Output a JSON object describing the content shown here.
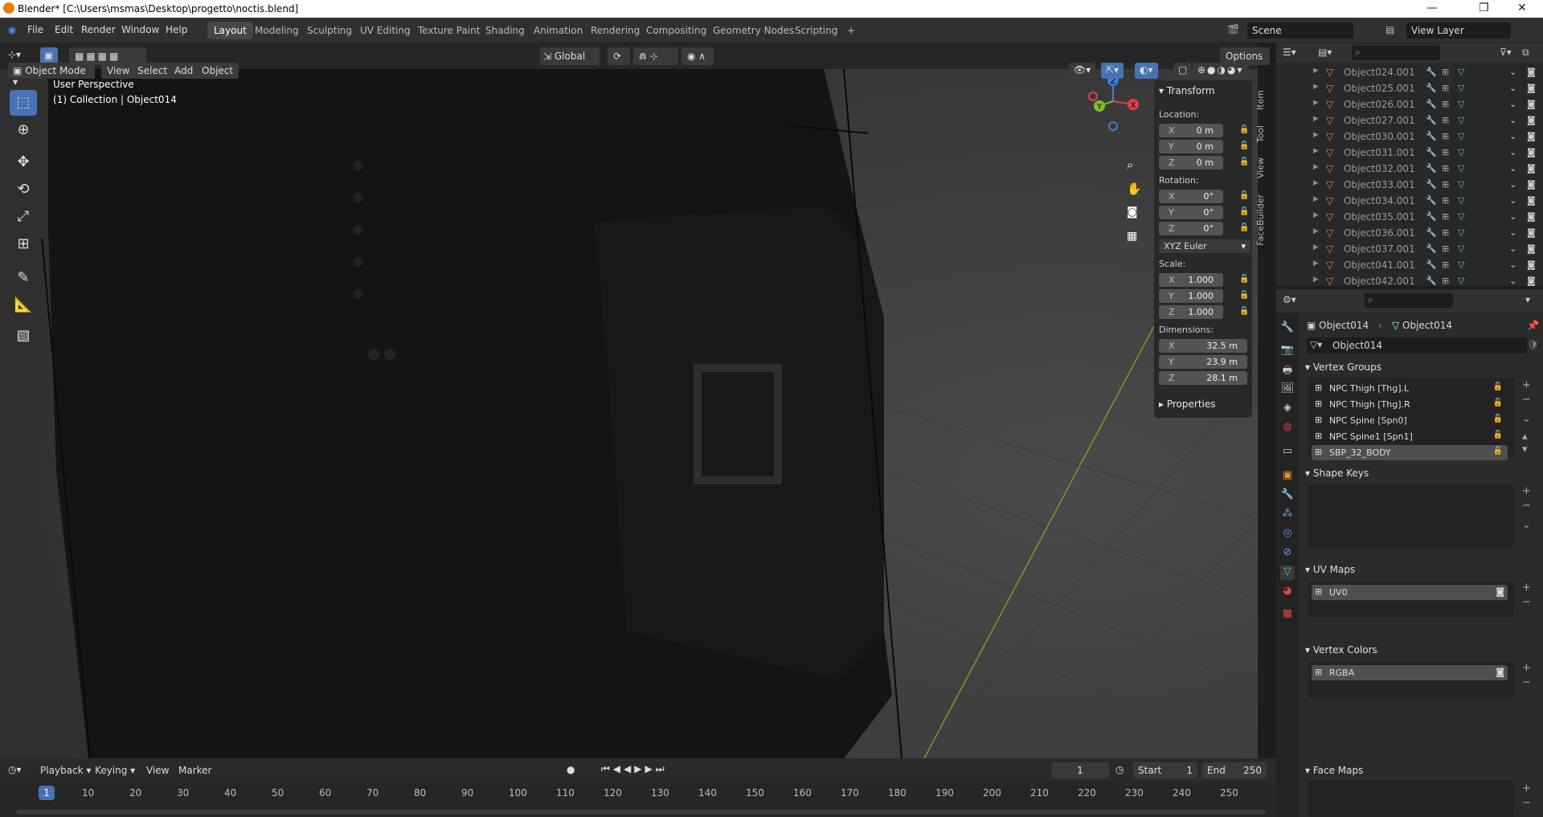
{
  "window": {
    "title": "Blender* [C:\\Users\\msmas\\Desktop\\progetto\\noctis.blend]",
    "controls": [
      "—",
      "❐",
      "✕"
    ]
  },
  "menus": [
    "File",
    "Edit",
    "Render",
    "Window",
    "Help"
  ],
  "workspaces": [
    "Layout",
    "Modeling",
    "Sculpting",
    "UV Editing",
    "Texture Paint",
    "Shading",
    "Animation",
    "Rendering",
    "Compositing",
    "Geometry Nodes",
    "Scripting",
    "+"
  ],
  "scene": {
    "name": "Scene",
    "view_layer": "View Layer"
  },
  "viewport_header": {
    "mode": "Object Mode",
    "menus": [
      "View",
      "Select",
      "Add",
      "Object"
    ],
    "transform_orientation": "Global",
    "options": "Options"
  },
  "viewport": {
    "perspective": "User Perspective",
    "collection_info": "(1) Collection | Object014"
  },
  "gizmo": {
    "axes": [
      "Z",
      "X",
      "Y"
    ],
    "colors": {
      "x": "#e0404a",
      "y": "#7fbd2c",
      "z": "#3d7fd8"
    }
  },
  "npanel": {
    "transform_title": "Transform",
    "location_label": "Location:",
    "location": [
      {
        "ax": "X",
        "v": "0 m"
      },
      {
        "ax": "Y",
        "v": "0 m"
      },
      {
        "ax": "Z",
        "v": "0 m"
      }
    ],
    "rotation_label": "Rotation:",
    "rotation": [
      {
        "ax": "X",
        "v": "0°"
      },
      {
        "ax": "Y",
        "v": "0°"
      },
      {
        "ax": "Z",
        "v": "0°"
      }
    ],
    "rotation_mode": "XYZ Euler",
    "scale_label": "Scale:",
    "scale": [
      {
        "ax": "X",
        "v": "1.000"
      },
      {
        "ax": "Y",
        "v": "1.000"
      },
      {
        "ax": "Z",
        "v": "1.000"
      }
    ],
    "dimensions_label": "Dimensions:",
    "dimensions": [
      {
        "ax": "X",
        "v": "32.5 m"
      },
      {
        "ax": "Y",
        "v": "23.9 m"
      },
      {
        "ax": "Z",
        "v": "28.1 m"
      }
    ],
    "properties_title": "Properties",
    "tabs": [
      "Item",
      "Tool",
      "View",
      "FaceBuilder"
    ]
  },
  "outliner": {
    "items": [
      "Object024.001",
      "Object025.001",
      "Object026.001",
      "Object027.001",
      "Object030.001",
      "Object031.001",
      "Object032.001",
      "Object033.001",
      "Object034.001",
      "Object035.001",
      "Object036.001",
      "Object037.001",
      "Object041.001",
      "Object042.001"
    ]
  },
  "properties": {
    "breadcrumb_object": "Object014",
    "breadcrumb_data": "Object014",
    "datablock_name": "Object014",
    "vertex_groups_title": "Vertex Groups",
    "vertex_groups": [
      "NPC Thigh [Thg].L",
      "NPC Thigh [Thg].R",
      "NPC Spine [Spn0]",
      "NPC Spine1 [Spn1]",
      "SBP_32_BODY"
    ],
    "shape_keys_title": "Shape Keys",
    "uv_maps_title": "UV Maps",
    "uv_maps": [
      "UV0"
    ],
    "vertex_colors_title": "Vertex Colors",
    "vertex_colors": [
      "RGBA"
    ],
    "face_maps_title": "Face Maps"
  },
  "timeline": {
    "menus": [
      "Playback",
      "Keying",
      "View",
      "Marker"
    ],
    "current_frame": "1",
    "start_label": "Start",
    "start": "1",
    "end_label": "End",
    "end": "250",
    "ticks": [
      "1",
      "10",
      "20",
      "30",
      "40",
      "50",
      "60",
      "70",
      "80",
      "90",
      "100",
      "110",
      "120",
      "130",
      "140",
      "150",
      "160",
      "170",
      "180",
      "190",
      "200",
      "210",
      "220",
      "230",
      "240",
      "250"
    ]
  }
}
